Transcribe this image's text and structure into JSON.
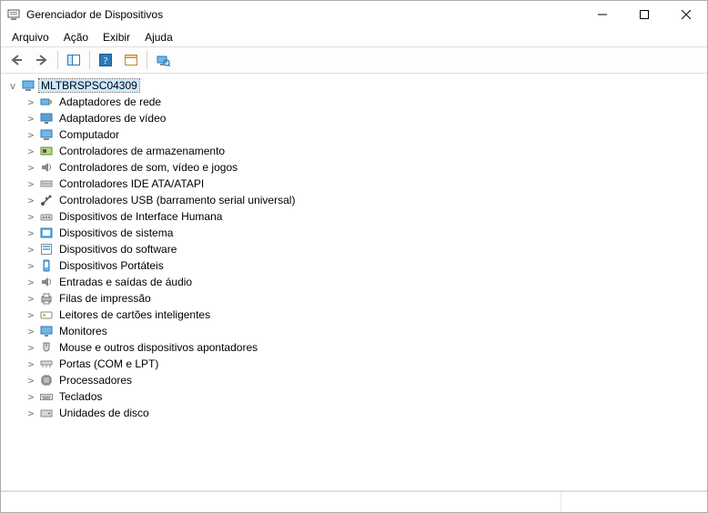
{
  "window": {
    "title": "Gerenciador de Dispositivos"
  },
  "menu": {
    "file": "Arquivo",
    "action": "Ação",
    "view": "Exibir",
    "help": "Ajuda"
  },
  "toolbar": {
    "back": "back",
    "forward": "forward",
    "show_hide": "show-hide-console-tree",
    "help": "help",
    "properties": "properties",
    "scan": "scan-for-hardware-changes"
  },
  "tree": {
    "root": {
      "label": "MLTBRSPSC04309",
      "icon": "computer-icon",
      "expanded": true,
      "selected": true,
      "children": [
        {
          "label": "Adaptadores de rede",
          "icon": "network-adapter-icon"
        },
        {
          "label": "Adaptadores de vídeo",
          "icon": "display-adapter-icon"
        },
        {
          "label": "Computador",
          "icon": "computer-node-icon"
        },
        {
          "label": "Controladores de armazenamento",
          "icon": "storage-controller-icon"
        },
        {
          "label": "Controladores de som, vídeo e jogos",
          "icon": "sound-controller-icon"
        },
        {
          "label": "Controladores IDE ATA/ATAPI",
          "icon": "ide-controller-icon"
        },
        {
          "label": "Controladores USB (barramento serial universal)",
          "icon": "usb-controller-icon"
        },
        {
          "label": "Dispositivos de Interface Humana",
          "icon": "hid-icon"
        },
        {
          "label": "Dispositivos de sistema",
          "icon": "system-device-icon"
        },
        {
          "label": "Dispositivos do software",
          "icon": "software-device-icon"
        },
        {
          "label": "Dispositivos Portáteis",
          "icon": "portable-device-icon"
        },
        {
          "label": "Entradas e saídas de áudio",
          "icon": "audio-io-icon"
        },
        {
          "label": "Filas de impressão",
          "icon": "print-queue-icon"
        },
        {
          "label": "Leitores de cartões inteligentes",
          "icon": "smart-card-reader-icon"
        },
        {
          "label": "Monitores",
          "icon": "monitor-icon"
        },
        {
          "label": "Mouse e outros dispositivos apontadores",
          "icon": "mouse-icon"
        },
        {
          "label": "Portas (COM e LPT)",
          "icon": "ports-icon"
        },
        {
          "label": "Processadores",
          "icon": "processor-icon"
        },
        {
          "label": "Teclados",
          "icon": "keyboard-icon"
        },
        {
          "label": "Unidades de disco",
          "icon": "disk-drive-icon"
        }
      ]
    }
  }
}
